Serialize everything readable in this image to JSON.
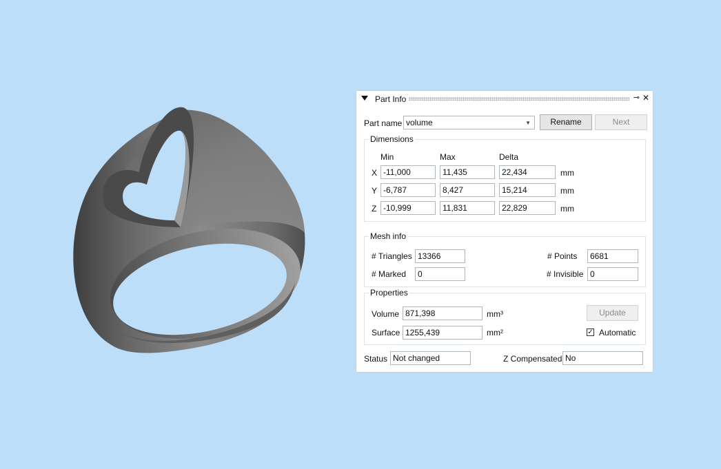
{
  "panel": {
    "title": "Part Info"
  },
  "part_name": {
    "label": "Part name",
    "value": "volume",
    "rename_button": "Rename",
    "next_button": "Next"
  },
  "dimensions": {
    "title": "Dimensions",
    "headers": {
      "min": "Min",
      "max": "Max",
      "delta": "Delta"
    },
    "unit": "mm",
    "rows": [
      {
        "axis": "X",
        "min": "-11,000",
        "max": "11,435",
        "delta": "22,434"
      },
      {
        "axis": "Y",
        "min": "-6,787",
        "max": "8,427",
        "delta": "15,214"
      },
      {
        "axis": "Z",
        "min": "-10,999",
        "max": "11,831",
        "delta": "22,829"
      }
    ]
  },
  "mesh_info": {
    "title": "Mesh info",
    "triangles_label": "# Triangles",
    "triangles_value": "13366",
    "points_label": "# Points",
    "points_value": "6681",
    "marked_label": "# Marked",
    "marked_value": "0",
    "invisible_label": "# Invisible",
    "invisible_value": "0"
  },
  "properties": {
    "title": "Properties",
    "volume_label": "Volume",
    "volume_value": "871,398",
    "volume_unit": "mm³",
    "surface_label": "Surface",
    "surface_value": "1255,439",
    "surface_unit": "mm²",
    "update_button": "Update",
    "automatic_label": "Automatic",
    "automatic_checked": true,
    "checkmark": "✓"
  },
  "status": {
    "label": "Status",
    "value": "Not changed",
    "z_label": "Z Compensated",
    "z_value": "No"
  },
  "icons": {
    "pin": "⊸",
    "close": "✕",
    "caret": "▼"
  }
}
